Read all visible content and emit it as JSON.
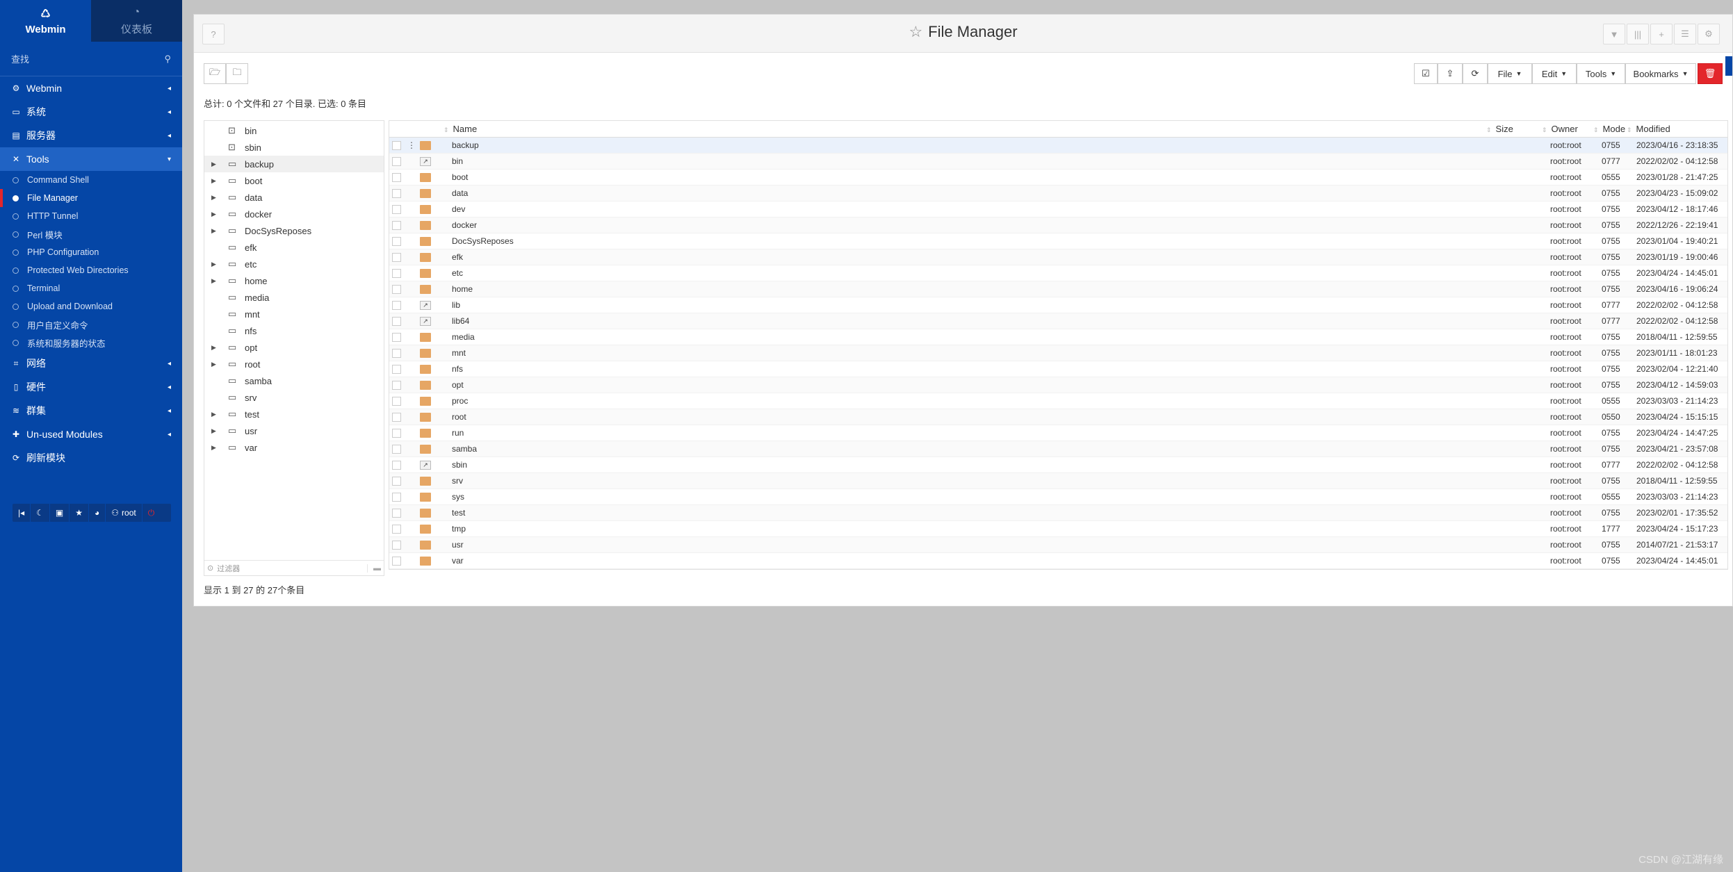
{
  "sidebar": {
    "tab_webmin": "Webmin",
    "tab_dashboard": "仪表板",
    "search_placeholder": "查找",
    "categories": [
      {
        "label": "Webmin",
        "icon": "gear-icon"
      },
      {
        "label": "系统",
        "icon": "monitor-icon"
      },
      {
        "label": "服务器",
        "icon": "server-icon"
      },
      {
        "label": "Tools",
        "icon": "wrench-icon"
      }
    ],
    "tools_items": [
      "Command Shell",
      "File Manager",
      "HTTP Tunnel",
      "Perl 模块",
      "PHP Configuration",
      "Protected Web Directories",
      "Terminal",
      "Upload and Download",
      "用户自定义命令",
      "系统和服务器的状态"
    ],
    "categories_after": [
      {
        "label": "网络",
        "icon": "network-icon"
      },
      {
        "label": "硬件",
        "icon": "hardware-icon"
      },
      {
        "label": "群集",
        "icon": "cluster-icon"
      },
      {
        "label": "Un-used Modules",
        "icon": "puzzle-icon"
      }
    ],
    "refresh": "刷新模块",
    "user": "root"
  },
  "header": {
    "title": "File Manager"
  },
  "toolbar": {
    "file": "File",
    "edit": "Edit",
    "tools": "Tools",
    "bookmarks": "Bookmarks"
  },
  "stats": "总计: 0 个文件和 27 个目录. 已选: 0 条目",
  "tree": {
    "items": [
      {
        "name": "bin",
        "expandable": false,
        "type": "link"
      },
      {
        "name": "sbin",
        "expandable": false,
        "type": "link"
      },
      {
        "name": "backup",
        "expandable": true,
        "type": "folder"
      },
      {
        "name": "boot",
        "expandable": true,
        "type": "folder"
      },
      {
        "name": "data",
        "expandable": true,
        "type": "folder"
      },
      {
        "name": "docker",
        "expandable": true,
        "type": "folder"
      },
      {
        "name": "DocSysReposes",
        "expandable": true,
        "type": "folder"
      },
      {
        "name": "efk",
        "expandable": false,
        "type": "folder"
      },
      {
        "name": "etc",
        "expandable": true,
        "type": "folder"
      },
      {
        "name": "home",
        "expandable": true,
        "type": "folder"
      },
      {
        "name": "media",
        "expandable": false,
        "type": "folder"
      },
      {
        "name": "mnt",
        "expandable": false,
        "type": "folder"
      },
      {
        "name": "nfs",
        "expandable": false,
        "type": "folder"
      },
      {
        "name": "opt",
        "expandable": true,
        "type": "folder"
      },
      {
        "name": "root",
        "expandable": true,
        "type": "folder"
      },
      {
        "name": "samba",
        "expandable": false,
        "type": "folder"
      },
      {
        "name": "srv",
        "expandable": false,
        "type": "folder"
      },
      {
        "name": "test",
        "expandable": true,
        "type": "folder"
      },
      {
        "name": "usr",
        "expandable": true,
        "type": "folder"
      },
      {
        "name": "var",
        "expandable": true,
        "type": "folder"
      }
    ],
    "filter_placeholder": "过滤器"
  },
  "table": {
    "columns": {
      "name": "Name",
      "size": "Size",
      "owner": "Owner",
      "mode": "Mode",
      "modified": "Modified"
    },
    "rows": [
      {
        "name": "backup",
        "type": "folder",
        "owner": "root:root",
        "mode": "0755",
        "modified": "2023/04/16 - 23:18:35"
      },
      {
        "name": "bin",
        "type": "link",
        "owner": "root:root",
        "mode": "0777",
        "modified": "2022/02/02 - 04:12:58"
      },
      {
        "name": "boot",
        "type": "folder",
        "owner": "root:root",
        "mode": "0555",
        "modified": "2023/01/28 - 21:47:25"
      },
      {
        "name": "data",
        "type": "folder",
        "owner": "root:root",
        "mode": "0755",
        "modified": "2023/04/23 - 15:09:02"
      },
      {
        "name": "dev",
        "type": "folder",
        "owner": "root:root",
        "mode": "0755",
        "modified": "2023/04/12 - 18:17:46"
      },
      {
        "name": "docker",
        "type": "folder",
        "owner": "root:root",
        "mode": "0755",
        "modified": "2022/12/26 - 22:19:41"
      },
      {
        "name": "DocSysReposes",
        "type": "folder",
        "owner": "root:root",
        "mode": "0755",
        "modified": "2023/01/04 - 19:40:21"
      },
      {
        "name": "efk",
        "type": "folder",
        "owner": "root:root",
        "mode": "0755",
        "modified": "2023/01/19 - 19:00:46"
      },
      {
        "name": "etc",
        "type": "folder",
        "owner": "root:root",
        "mode": "0755",
        "modified": "2023/04/24 - 14:45:01"
      },
      {
        "name": "home",
        "type": "folder",
        "owner": "root:root",
        "mode": "0755",
        "modified": "2023/04/16 - 19:06:24"
      },
      {
        "name": "lib",
        "type": "link",
        "owner": "root:root",
        "mode": "0777",
        "modified": "2022/02/02 - 04:12:58"
      },
      {
        "name": "lib64",
        "type": "link",
        "owner": "root:root",
        "mode": "0777",
        "modified": "2022/02/02 - 04:12:58"
      },
      {
        "name": "media",
        "type": "folder",
        "owner": "root:root",
        "mode": "0755",
        "modified": "2018/04/11 - 12:59:55"
      },
      {
        "name": "mnt",
        "type": "folder",
        "owner": "root:root",
        "mode": "0755",
        "modified": "2023/01/11 - 18:01:23"
      },
      {
        "name": "nfs",
        "type": "folder",
        "owner": "root:root",
        "mode": "0755",
        "modified": "2023/02/04 - 12:21:40"
      },
      {
        "name": "opt",
        "type": "folder",
        "owner": "root:root",
        "mode": "0755",
        "modified": "2023/04/12 - 14:59:03"
      },
      {
        "name": "proc",
        "type": "folder",
        "owner": "root:root",
        "mode": "0555",
        "modified": "2023/03/03 - 21:14:23"
      },
      {
        "name": "root",
        "type": "folder",
        "owner": "root:root",
        "mode": "0550",
        "modified": "2023/04/24 - 15:15:15"
      },
      {
        "name": "run",
        "type": "folder",
        "owner": "root:root",
        "mode": "0755",
        "modified": "2023/04/24 - 14:47:25"
      },
      {
        "name": "samba",
        "type": "folder",
        "owner": "root:root",
        "mode": "0755",
        "modified": "2023/04/21 - 23:57:08"
      },
      {
        "name": "sbin",
        "type": "link",
        "owner": "root:root",
        "mode": "0777",
        "modified": "2022/02/02 - 04:12:58"
      },
      {
        "name": "srv",
        "type": "folder",
        "owner": "root:root",
        "mode": "0755",
        "modified": "2018/04/11 - 12:59:55"
      },
      {
        "name": "sys",
        "type": "folder",
        "owner": "root:root",
        "mode": "0555",
        "modified": "2023/03/03 - 21:14:23"
      },
      {
        "name": "test",
        "type": "folder",
        "owner": "root:root",
        "mode": "0755",
        "modified": "2023/02/01 - 17:35:52"
      },
      {
        "name": "tmp",
        "type": "folder",
        "owner": "root:root",
        "mode": "1777",
        "modified": "2023/04/24 - 15:17:23"
      },
      {
        "name": "usr",
        "type": "folder",
        "owner": "root:root",
        "mode": "0755",
        "modified": "2014/07/21 - 21:53:17"
      },
      {
        "name": "var",
        "type": "folder",
        "owner": "root:root",
        "mode": "0755",
        "modified": "2023/04/24 - 14:45:01"
      }
    ]
  },
  "footer_showing": "显示 1 到 27 的 27个条目",
  "watermark": "CSDN @江湖有缘"
}
